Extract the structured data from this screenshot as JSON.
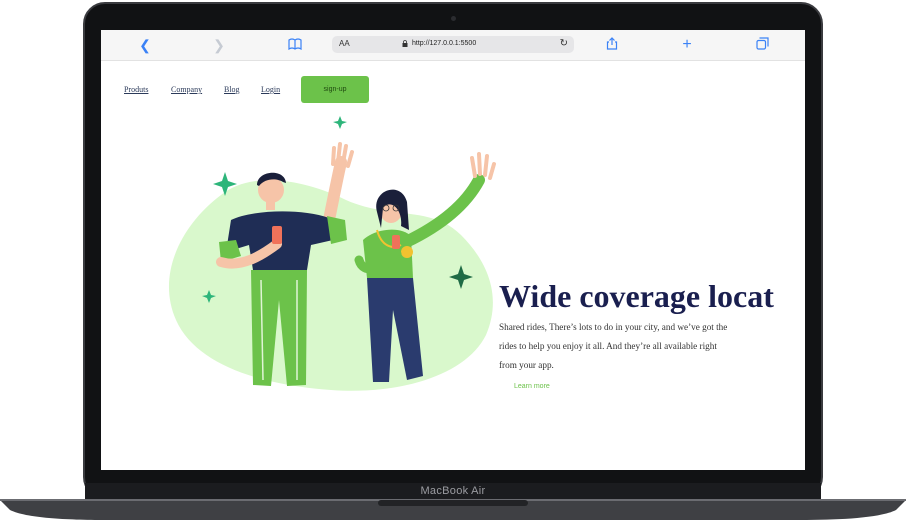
{
  "device": {
    "model_label": "MacBook Air"
  },
  "browser": {
    "reader_label": "AA",
    "url": "http://127.0.0.1:5500",
    "icons": [
      "back-icon",
      "forward-icon",
      "book-icon",
      "lock-icon",
      "reload-icon",
      "share-icon",
      "add-tab-icon",
      "tabs-icon"
    ]
  },
  "nav": {
    "links": [
      "Produts",
      "Company",
      "Blog",
      "Login"
    ],
    "signup_label": "sign-up"
  },
  "hero": {
    "title": "Wide coverage locat",
    "description": "Shared rides, There’s lots to do in your city, and we’ve got the rides to help you enjoy it all. And they’re all available right from your app.",
    "learn_more": "Learn more"
  },
  "colors": {
    "accent_green": "#6cc24a",
    "blob_green": "#d9f8cc",
    "navy": "#1a1f4f",
    "sparkle_green": "#2db57a"
  }
}
